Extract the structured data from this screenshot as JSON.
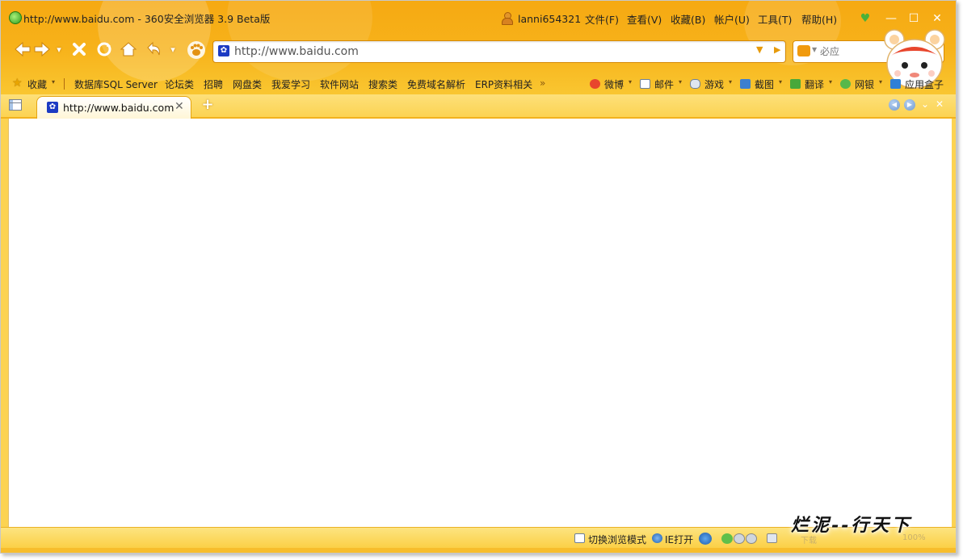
{
  "window": {
    "title": "http://www.baidu.com - 360安全浏览器 3.9 Beta版",
    "user": "lanni654321",
    "menus": [
      "文件(F)",
      "查看(V)",
      "收藏(B)",
      "帐户(U)",
      "工具(T)",
      "帮助(H)"
    ],
    "controls": [
      "minimize",
      "maximize",
      "close"
    ]
  },
  "nav": {
    "back_icon": "back-arrow",
    "forward_icon": "forward-arrow",
    "url": "http://www.baidu.com",
    "search_placeholder": "必应"
  },
  "bookmarks": {
    "favorites_label": "收藏",
    "items": [
      "数据库SQL Server",
      "论坛类",
      "招聘",
      "网盘类",
      "我爱学习",
      "软件网站",
      "搜索类",
      "免费域名解析",
      "ERP资料相关"
    ],
    "more": "»",
    "tools": [
      "微博",
      "邮件",
      "游戏",
      "截图",
      "翻译",
      "网银",
      "应用盒子"
    ]
  },
  "tabs": [
    {
      "title": "http://www.baidu.com",
      "active": true
    }
  ],
  "status": {
    "switch_mode": "切换浏览模式",
    "ie_open": "IE打开",
    "download": "下载",
    "zoom": "100%"
  },
  "watermark": "烂泥--行天下",
  "colors": {
    "chrome_orange": "#f7b21a",
    "tab_yellow": "#fcd352",
    "url_border": "#d68a06"
  }
}
